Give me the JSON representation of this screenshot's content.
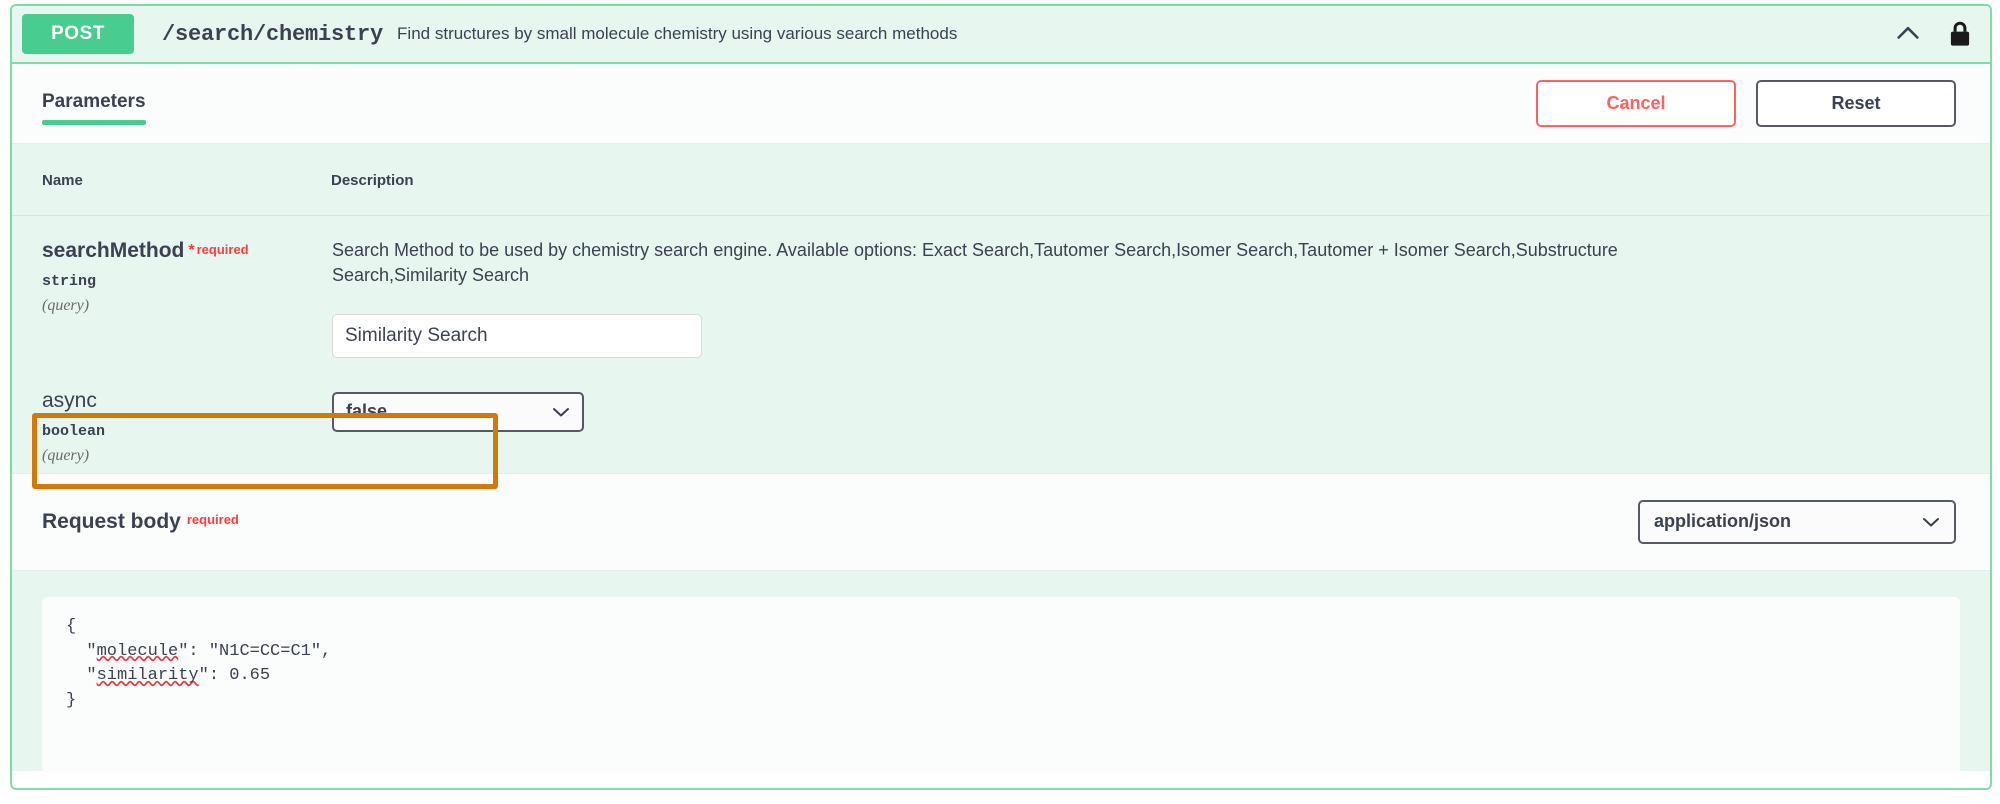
{
  "operation": {
    "method": "POST",
    "path": "/search/chemistry",
    "summary": "Find structures by small molecule chemistry using various search methods",
    "collapse_icon": "chevron-up-icon",
    "auth_icon": "lock-icon"
  },
  "tabs": {
    "parameters_label": "Parameters",
    "cancel_label": "Cancel",
    "reset_label": "Reset"
  },
  "table_headers": {
    "name": "Name",
    "description": "Description"
  },
  "parameters": [
    {
      "name": "searchMethod",
      "required_star": "*",
      "required_label": "required",
      "type": "string",
      "in": "(query)",
      "description": "Search Method to be used by chemistry search engine. Available options: Exact Search,Tautomer Search,Isomer Search,Tautomer + Isomer Search,Substructure Search,Similarity Search",
      "control": "text",
      "value": "Similarity Search"
    },
    {
      "name": "async",
      "required_star": "",
      "required_label": "",
      "type": "boolean",
      "in": "(query)",
      "description": "",
      "control": "select",
      "value": "false",
      "highlighted": true
    }
  ],
  "request_body": {
    "title": "Request body",
    "required_label": "required",
    "content_type": "application/json",
    "content_type_caret": "chevron-down-icon",
    "code_lines": [
      "{",
      "  \"molecule\": \"N1C=CC=C1\",",
      "  \"similarity\": 0.65",
      "}"
    ],
    "code_spellchecked": [
      "molecule",
      "similarity"
    ]
  },
  "colors": {
    "post_green": "#49cc90",
    "panel_green_bg": "#e8f6f0",
    "border_green": "#7ddcaa",
    "required_red": "#f93e3e",
    "cancel_red": "#ff6060",
    "highlight_orange": "#d3790b",
    "text_dark": "#3b4151"
  }
}
